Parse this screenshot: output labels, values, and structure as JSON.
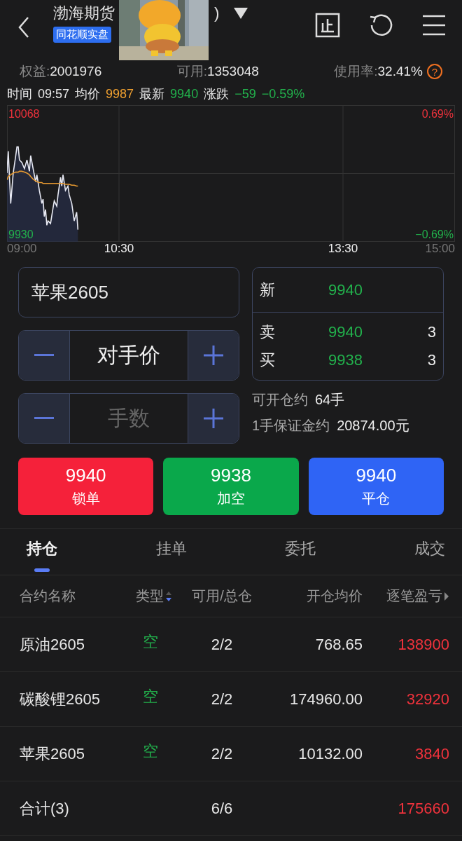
{
  "header": {
    "title": "渤海期货",
    "title_tail": ")",
    "badge": "同花顺实盘",
    "dropdown_open": false
  },
  "account": [
    {
      "label": "权益:",
      "value": "2001976"
    },
    {
      "label": "可用:",
      "value": "1353048"
    },
    {
      "label": "使用率:",
      "value": "32.41%",
      "help": "?"
    }
  ],
  "quote_line": [
    {
      "label": "时间",
      "value": "09:57",
      "color": "#e8e8e8"
    },
    {
      "label": "均价",
      "value": "9987",
      "color": "#f0a030"
    },
    {
      "label": "最新",
      "value": "9940",
      "color": "#22b14c"
    },
    {
      "label": "涨跌",
      "value": "−59",
      "color": "#22b14c"
    },
    {
      "value": "−0.59%",
      "color": "#22b14c"
    }
  ],
  "chart": {
    "right_labels": [
      {
        "text": "0.69%",
        "color": "#f0323c"
      },
      {
        "text": "−0.69%",
        "color": "#22b14c"
      }
    ],
    "chart_data": {
      "type": "line",
      "x": [
        9,
        9.017,
        9.05,
        9.083,
        9.117,
        9.133,
        9.15,
        9.167,
        9.2,
        9.233,
        9.267,
        9.3,
        9.317,
        9.35,
        9.383,
        9.4,
        9.433,
        9.467,
        9.483,
        9.5,
        9.517,
        9.533,
        9.55,
        9.583,
        9.617,
        9.633,
        9.667,
        9.683,
        9.717,
        9.733,
        9.75,
        9.783,
        9.817,
        9.833,
        9.867,
        9.9,
        9.933,
        9.95
      ],
      "series": [
        {
          "type": "area",
          "color": "#e6e8f2",
          "values": [
            10000,
            10025,
            9965,
            10000,
            10020,
            10030,
            10030,
            10015,
            10012,
            10005,
            10015,
            10002,
            10020,
            10005,
            9990,
            9998,
            9980,
            9965,
            9970,
            9950,
            9958,
            9940,
            9945,
            9942,
            9960,
            9968,
            9962,
            9975,
            9995,
            9985,
            9998,
            9980,
            9985,
            9975,
            9965,
            9945,
            9955,
            9935
          ]
        },
        {
          "type": "line",
          "color": "#e89a30",
          "values": [
            9992,
            9996,
            9998,
            10000,
            10001,
            10001,
            10001,
            10002,
            10002,
            10001,
            10000,
            9998,
            9996,
            9993,
            9991,
            9990,
            9989,
            9989,
            9988,
            9988,
            9988,
            9988,
            9988,
            9988,
            9988,
            9988,
            9988,
            9988,
            9988,
            9988,
            9988,
            9987,
            9987,
            9987,
            9986,
            9986,
            9985,
            9985
          ]
        }
      ],
      "xlim": [
        9,
        15
      ],
      "ylim": [
        9921,
        10078
      ],
      "xticks": [
        {
          "value": 9,
          "label": "09:00"
        },
        {
          "value": 10.5,
          "label": "10:30"
        },
        {
          "value": 13.5,
          "label": "13:30"
        },
        {
          "value": 15,
          "label": "15:00"
        }
      ],
      "yticks": [
        {
          "value": 9930,
          "label": "9930"
        },
        {
          "value": 10068,
          "label": "10068"
        }
      ]
    }
  },
  "order": {
    "contract": "苹果2605",
    "price_mode": "对手价",
    "qty_placeholder": "手数",
    "book": [
      {
        "label": "新",
        "price": "9940"
      },
      {
        "label": "卖",
        "price": "9940",
        "size": "3"
      },
      {
        "label": "买",
        "price": "9938",
        "size": "3"
      }
    ],
    "info": [
      {
        "label": "可开仓约",
        "value": "64手"
      },
      {
        "label": "1手保证金约",
        "value": "20874.00元"
      }
    ],
    "actions": [
      {
        "price": "9940",
        "label": "锁单",
        "color": "#f5213a"
      },
      {
        "price": "9938",
        "label": "加空",
        "color": "#0aa84b"
      },
      {
        "price": "9940",
        "label": "平仓",
        "color": "#2f64f5"
      }
    ]
  },
  "tabs": [
    {
      "label": "持仓",
      "selected": true
    },
    {
      "label": "挂单",
      "selected": false
    },
    {
      "label": "委托",
      "selected": false
    },
    {
      "label": "成交",
      "selected": false
    }
  ],
  "table": {
    "columns": [
      "合约名称",
      "类型",
      "可用/总仓",
      "开仓均价",
      "逐笔盈亏"
    ],
    "rows": [
      {
        "name": "原油2605",
        "type": "空",
        "avail": "2/2",
        "avg": "768.65",
        "pnl": "138900"
      },
      {
        "name": "碳酸锂2605",
        "type": "空",
        "avail": "2/2",
        "avg": "174960.00",
        "pnl": "32920"
      },
      {
        "name": "苹果2605",
        "type": "空",
        "avail": "2/2",
        "avg": "10132.00",
        "pnl": "3840"
      }
    ],
    "total": {
      "name": "合计(3)",
      "avail": "6/6",
      "pnl": "175660"
    }
  }
}
